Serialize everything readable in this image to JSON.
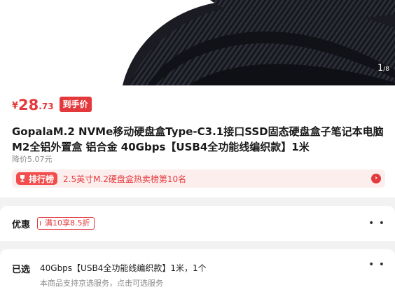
{
  "gallery": {
    "current": "1",
    "total": "/8"
  },
  "price": {
    "symbol": "¥",
    "integer": "28",
    "decimal": ".73",
    "tag": "到手价"
  },
  "product": {
    "title_line1": "GopalaM.2 NVMe移动硬盘盒Type-C3.1接口SSD固态硬盘盒子笔记本电脑",
    "title_line2": "M2全铝外置盒 铝合金 40Gbps【USB4全功能线编织款】1米",
    "price_drop": "降价5.07元"
  },
  "ranking": {
    "badge": "排行榜",
    "text": "2.5英寸M.2硬盘盒热卖榜第10名",
    "arrow": "›"
  },
  "promo": {
    "label": "优惠",
    "coupon": "满10享8.5折",
    "more": "• •"
  },
  "selected": {
    "label": "已选",
    "value": "40Gbps【USB4全功能线编织款】1米，1个",
    "note": "本商品支持京选服务，点击可选服务",
    "more": "• •"
  },
  "colors": {
    "accent": "#e4393c",
    "rank_bg": "#fdeeee",
    "page_bg": "#f2f2f2"
  }
}
